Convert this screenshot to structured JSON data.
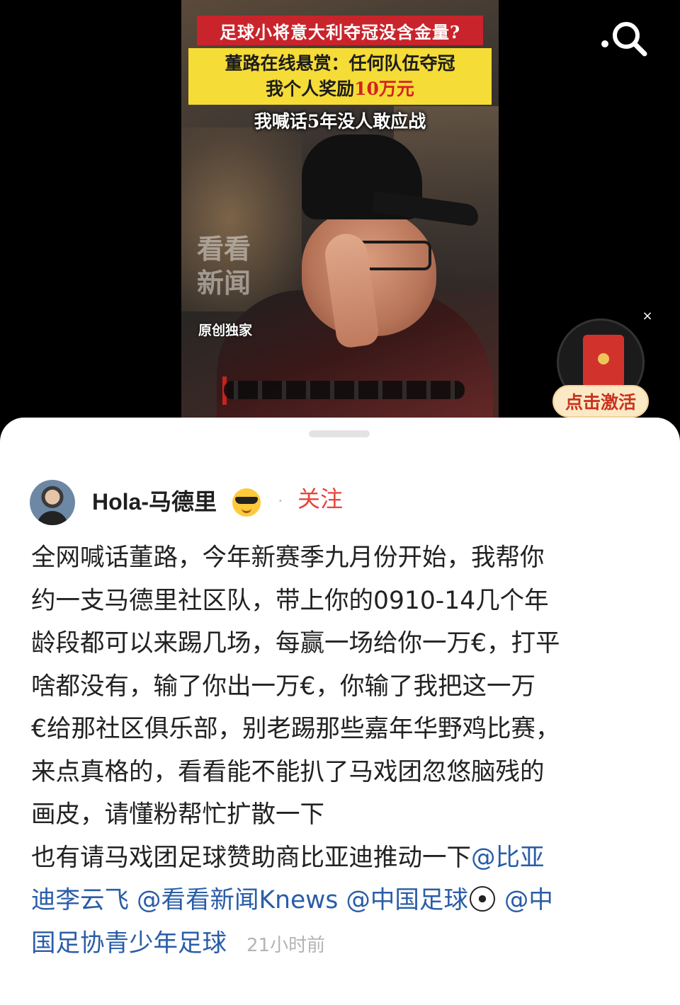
{
  "video": {
    "caption_top": "足球小将意大利夺冠没含金量?",
    "caption_yellow_line1": "董路在线悬赏：任何队伍夺冠",
    "caption_yellow_line2_prefix": "我个人奖励",
    "caption_yellow_line2_highlight": "10万元",
    "caption_sub": "我喊话5年没人敢应战",
    "watermark_line1": "看看",
    "watermark_line2": "新闻",
    "watermark_small": "原创独家"
  },
  "search_icon": "search-icon",
  "redpacket": {
    "label": "点击激活",
    "close": "×"
  },
  "post": {
    "author_name": "Hola-马德里",
    "author_emoji": "sunglasses-emoji",
    "separator": "·",
    "follow_label": "关注",
    "lines": [
      "全网喊话董路，今年新赛季九月份开始，我帮你",
      "约一支马德里社区队，带上你的0910-14几个年",
      "龄段都可以来踢几场，每赢一场给你一万€，打平",
      "啥都没有，输了你出一万€，你输了我把这一万",
      "€给那社区俱乐部，别老踢那些嘉年华野鸡比赛，",
      "来点真格的，看看能不能扒了马戏团忽悠脑残的",
      "画皮，请懂粉帮忙扩散一下"
    ],
    "line8_text": "也有请马戏团足球赞助商比亚迪推动一下",
    "mention_1a": "@比亚",
    "mention_1b": "迪李云飞",
    "mention_2": "@看看新闻Knews",
    "mention_3": "@中国足球",
    "mention_4a": "@中",
    "mention_4b": "国足协青少年足球",
    "timestamp": "21小时前"
  }
}
